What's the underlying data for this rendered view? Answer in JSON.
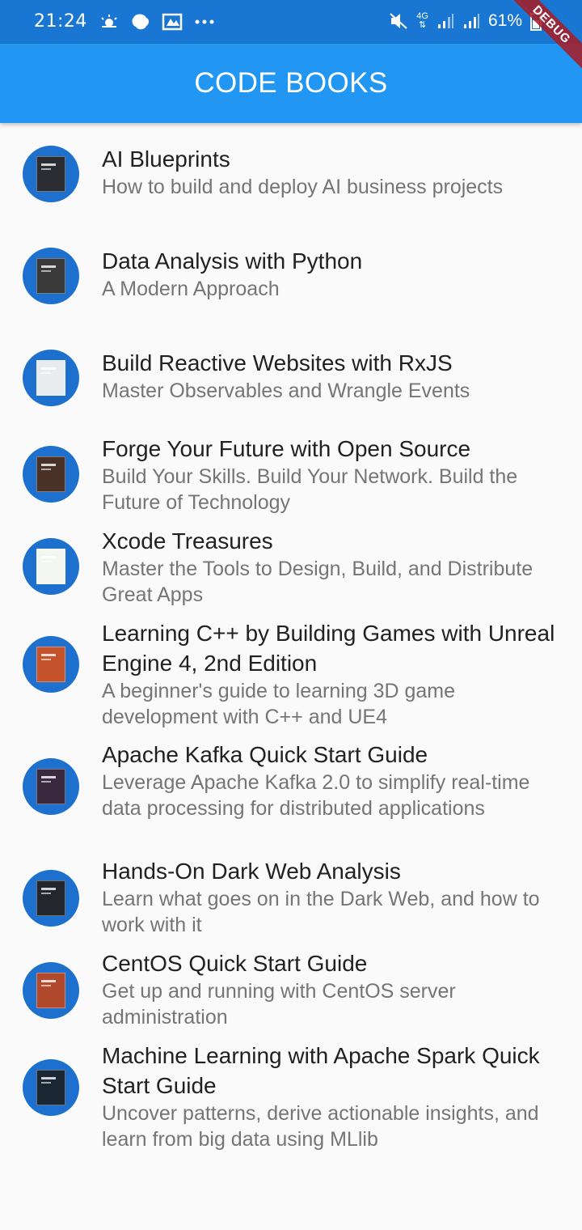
{
  "status_bar": {
    "time": "21:24",
    "battery": "61%",
    "network": "4G",
    "left_icons": [
      "weather-icon",
      "bixby-icon",
      "gallery-icon",
      "more-icon"
    ],
    "right_icons": [
      "mute-icon",
      "network-icon",
      "signal-icon",
      "signal-icon",
      "battery-icon"
    ]
  },
  "debug_banner": "DEBUG",
  "app_bar": {
    "title": "CODE BOOKS"
  },
  "colors": {
    "app_bar": "#2196f3",
    "status_bar": "#1976d2",
    "avatar": "#1e70cf",
    "title": "#212121",
    "subtitle": "#757575"
  },
  "books": [
    {
      "title": "AI Blueprints",
      "subtitle": "How to build and deploy AI business projects",
      "cover_color": "#2b2d33"
    },
    {
      "title": "Data Analysis with Python",
      "subtitle": "A Modern Approach",
      "cover_color": "#3a3a3a"
    },
    {
      "title": "Build Reactive Websites with RxJS",
      "subtitle": "Master Observables and Wrangle Events",
      "cover_color": "#e8ecef"
    },
    {
      "title": "Forge Your Future with Open Source",
      "subtitle": "Build Your Skills. Build Your Network. Build the Future of Technology",
      "cover_color": "#4a3128"
    },
    {
      "title": "Xcode Treasures",
      "subtitle": "Master the Tools to Design, Build, and Distribute Great Apps",
      "cover_color": "#f4f6f2"
    },
    {
      "title": "Learning C++ by Building Games with Unreal Engine 4, 2nd Edition",
      "subtitle": "A beginner's guide to learning 3D game development with C++ and UE4",
      "cover_color": "#c4522a"
    },
    {
      "title": "Apache Kafka Quick Start Guide",
      "subtitle": "Leverage Apache Kafka 2.0 to simplify real-time data processing for distributed applications",
      "cover_color": "#3b2a3f"
    },
    {
      "title": "Hands-On Dark Web Analysis",
      "subtitle": "Learn what goes on in the Dark Web, and how to work with it",
      "cover_color": "#23262c"
    },
    {
      "title": "CentOS Quick Start Guide",
      "subtitle": "Get up and running with CentOS server administration",
      "cover_color": "#b14a2d"
    },
    {
      "title": "Machine Learning with Apache Spark Quick Start Guide",
      "subtitle": "Uncover patterns, derive actionable insights, and learn from big data using MLlib",
      "cover_color": "#1c2734"
    }
  ]
}
